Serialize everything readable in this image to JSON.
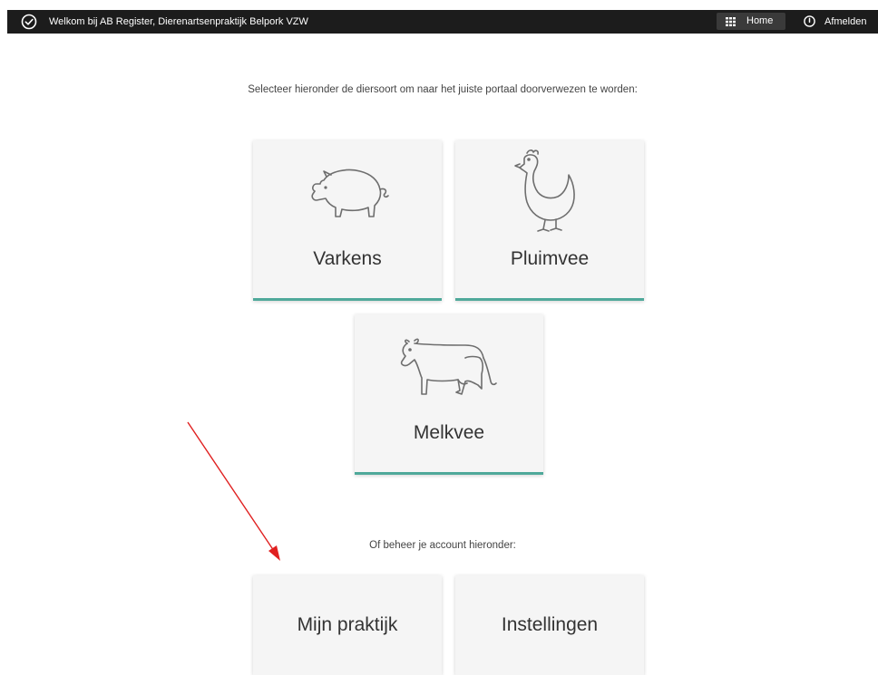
{
  "header": {
    "welcome_text": "Welkom bij AB Register, Dierenartsenpraktijk Belpork VZW",
    "home_label": "Home",
    "logout_label": "Afmelden",
    "icons": {
      "status": "check-circle-icon",
      "home": "grid-icon",
      "logout": "power-icon"
    }
  },
  "main": {
    "intro_text": "Selecteer hieronder de diersoort om naar het juiste portaal doorverwezen te worden:",
    "species": [
      {
        "label": "Varkens",
        "icon": "pig-icon"
      },
      {
        "label": "Pluimvee",
        "icon": "chicken-icon"
      },
      {
        "label": "Melkvee",
        "icon": "cow-icon"
      }
    ],
    "manage_text": "Of beheer je account hieronder:",
    "account": [
      {
        "label": "Mijn praktijk"
      },
      {
        "label": "Instellingen"
      }
    ]
  },
  "colors": {
    "topbar_bg": "#1c1c1c",
    "card_bg": "#f5f5f5",
    "card_accent": "#4fa99a",
    "annotation_arrow": "#e02020"
  }
}
